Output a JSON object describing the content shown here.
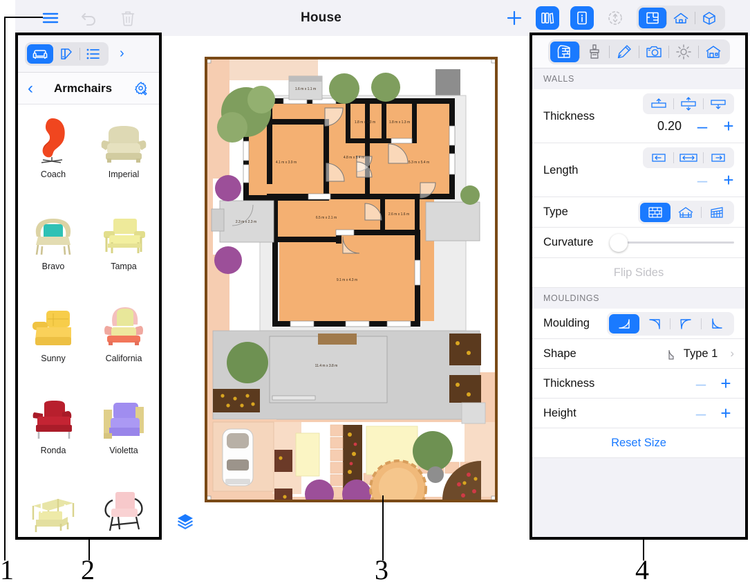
{
  "app": {
    "title": "House"
  },
  "toolbar": {
    "menu_icon": "hamburger-menu-icon",
    "undo_icon": "undo-icon",
    "delete_icon": "trash-icon",
    "add_label": "+",
    "library_icon": "library-books-icon",
    "info_icon": "info-icon",
    "move_icon": "move-arrows-icon",
    "view_modes": [
      {
        "icon": "floorplan-2d-icon",
        "label": "2D Plan",
        "active": true
      },
      {
        "icon": "elevation-house-icon",
        "label": "Elevation",
        "active": false
      },
      {
        "icon": "3d-box-icon",
        "label": "3D View",
        "active": false
      }
    ]
  },
  "sidebar": {
    "tabs": [
      {
        "icon": "armchair-furniture-icon",
        "label": "Furniture",
        "active": true
      },
      {
        "icon": "color-palette-icon",
        "label": "Materials",
        "active": false
      },
      {
        "icon": "list-icon",
        "label": "List",
        "active": false
      }
    ],
    "expand_icon": "chevron-right-icon",
    "back_icon": "chevron-left-icon",
    "category_title": "Armchairs",
    "settings_icon": "gear-tools-icon",
    "items": [
      {
        "label": "Coach",
        "color": "#f0461f",
        "style": "egg"
      },
      {
        "label": "Imperial",
        "color": "#ded9b4",
        "style": "plush"
      },
      {
        "label": "Bravo",
        "color": "#dcd3a4",
        "accent": "#2fc1b5",
        "style": "wicker"
      },
      {
        "label": "Tampa",
        "color": "#eeea9a",
        "style": "boxy"
      },
      {
        "label": "Sunny",
        "color": "#f7cd4a",
        "style": "tufted"
      },
      {
        "label": "California",
        "color": "#f4c0bd",
        "accent": "#e8e79a",
        "style": "wing"
      },
      {
        "label": "Ronda",
        "color": "#b81f2d",
        "style": "club"
      },
      {
        "label": "Violetta",
        "color": "#a08df0",
        "accent": "#e0cf8a",
        "style": "modern"
      },
      {
        "label": "",
        "color": "#ecea9d",
        "style": "frame"
      },
      {
        "label": "",
        "color": "#f7c9cb",
        "accent": "#2b2b2b",
        "style": "bentwood"
      }
    ]
  },
  "canvas": {
    "layers_icon": "layers-stack-icon",
    "plan_name": "House floor plan",
    "room_labels": [
      "1.6 m x 1.1 m",
      "1.8 m x 1.3 m",
      "1.8 m x 1.3 m",
      "4.1 m x 3.9 m",
      "4.8 m x 5.4 m",
      "5.3 m x 5.4 m",
      "2.3 m x 2.3 m",
      "6.5 m x 2.1 m",
      "2.6 m x 1.6 m",
      "9.1 m x 4.3 m",
      "11.4 m x 3.8 m"
    ],
    "colors": {
      "ground": "#f6cdb1",
      "room_fill": "#f4b072",
      "wall": "#111111",
      "paving": "#cfcfcf",
      "lawn": "#ffffff",
      "border": "#7a4a16"
    }
  },
  "inspector": {
    "tabs": [
      {
        "icon": "wall-tool-icon",
        "label": "Walls",
        "active": true
      },
      {
        "icon": "paint-brush-icon",
        "label": "Paint",
        "active": false
      },
      {
        "icon": "pencil-icon",
        "label": "Draw",
        "active": false
      },
      {
        "icon": "camera-icon",
        "label": "Camera",
        "active": false
      },
      {
        "icon": "sun-light-icon",
        "label": "Light",
        "active": false
      },
      {
        "icon": "house-icon",
        "label": "Building",
        "active": false
      }
    ],
    "walls": {
      "section_title": "WALLS",
      "thickness": {
        "label": "Thickness",
        "value": "0.20",
        "minus": "–",
        "plus": "+",
        "align_options": [
          {
            "icon": "align-thickness-top-icon",
            "active": false
          },
          {
            "icon": "align-thickness-center-icon",
            "active": false
          },
          {
            "icon": "align-thickness-bottom-icon",
            "active": false
          }
        ]
      },
      "length": {
        "label": "Length",
        "minus": "–",
        "plus": "+",
        "align_options": [
          {
            "icon": "align-length-left-icon",
            "active": false
          },
          {
            "icon": "align-length-center-icon",
            "active": false
          },
          {
            "icon": "align-length-right-icon",
            "active": false
          }
        ]
      },
      "type": {
        "label": "Type",
        "options": [
          {
            "icon": "brick-wall-icon",
            "active": true
          },
          {
            "icon": "gable-wall-icon",
            "active": false
          },
          {
            "icon": "glass-wall-icon",
            "active": false
          }
        ]
      },
      "curvature": {
        "label": "Curvature",
        "value": 0
      },
      "flip_sides": {
        "label": "Flip Sides",
        "enabled": false
      }
    },
    "mouldings": {
      "section_title": "MOULDINGS",
      "moulding": {
        "label": "Moulding",
        "options": [
          {
            "icon": "moulding-both-icon",
            "active": true
          },
          {
            "icon": "moulding-top-icon",
            "active": false
          },
          {
            "icon": "moulding-upper-icon",
            "active": false
          },
          {
            "icon": "moulding-base-icon",
            "active": false
          }
        ]
      },
      "shape": {
        "label": "Shape",
        "value": "Type 1",
        "chevron": "›",
        "preview_icon": "moulding-profile-icon"
      },
      "thickness": {
        "label": "Thickness",
        "minus": "–",
        "plus": "+"
      },
      "height": {
        "label": "Height",
        "minus": "–",
        "plus": "+"
      },
      "reset": {
        "label": "Reset Size"
      }
    }
  },
  "annotations": [
    {
      "number": "1",
      "target": "hamburger-menu-icon"
    },
    {
      "number": "2",
      "target": "furniture-sidebar"
    },
    {
      "number": "3",
      "target": "floor-plan-canvas"
    },
    {
      "number": "4",
      "target": "properties-inspector"
    }
  ]
}
